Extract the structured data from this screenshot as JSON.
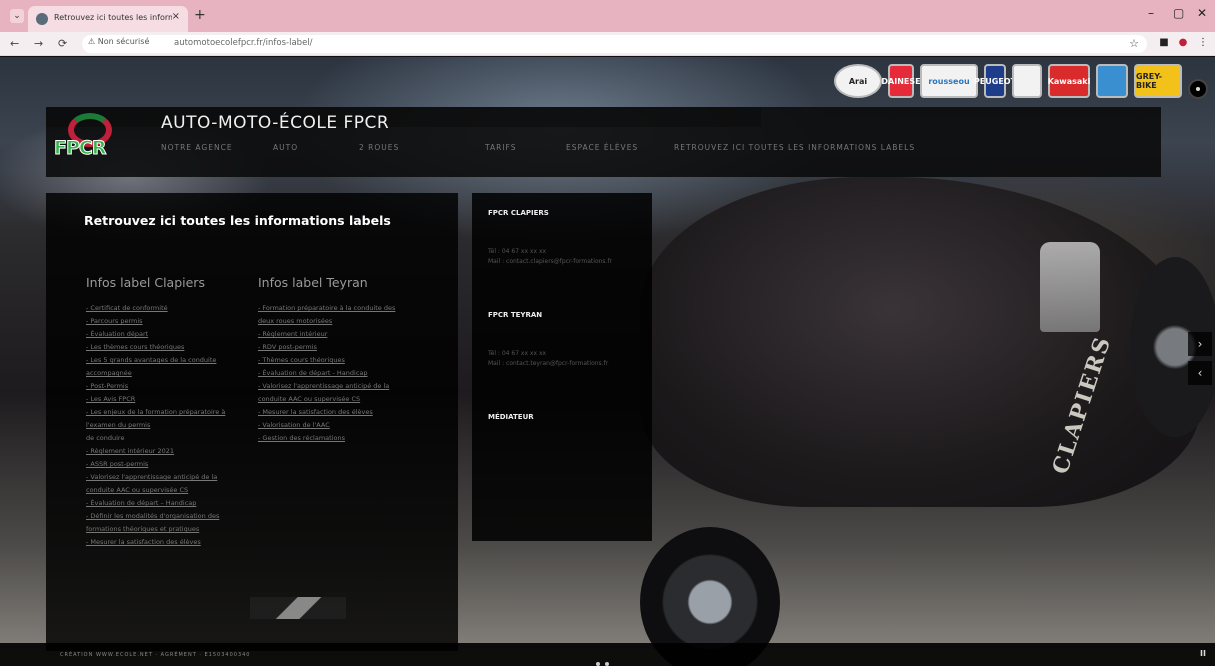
{
  "browser": {
    "tab_title": "Retrouvez ici toutes les inform",
    "tab_close": "×",
    "new_tab": "+",
    "security_label": "Non sécurisé",
    "url": "automotoecolefpcr.fr/infos-label/",
    "win_minimize": "–",
    "win_maximize": "▢",
    "win_close": "✕"
  },
  "sponsors": [
    "Arai",
    "DAINESE",
    "rousseou",
    "PEUGEOT",
    "",
    "Kawasaki",
    "",
    "GREY-BIKE"
  ],
  "header": {
    "logo_text": "FPCR",
    "site_title": "AUTO-MOTO-ÉCOLE FPCR",
    "nav": [
      "NOTRE AGENCE",
      "AUTO",
      "2 ROUES",
      "TARIFS",
      "ESPACE ÉLÈVES",
      "RETROUVEZ ICI TOUTES LES INFORMATIONS LABELS"
    ]
  },
  "main": {
    "title": "Retrouvez ici toutes les informations labels",
    "clapiers": {
      "heading": "Infos label Clapiers",
      "items": [
        "- Certificat de conformité",
        "- Parcours permis",
        "- Évaluation départ",
        "- Les thèmes cours théoriques",
        "- Les 5 grands avantages de la conduite",
        "accompagnée",
        "- Post-Permis",
        "- Les Avis FPCR",
        "- Les enjeux de la formation préparatoire à",
        "l'examen du permis",
        "de conduire",
        "- Règlement intérieur 2021",
        "- ASSR post-permis",
        "- Valorisez l'apprentissage anticipé de la",
        "conduite AAC ou supervisée CS",
        "- Évaluation de départ – Handicap",
        "- Définir les modalités d'organisation des",
        "formations théoriques et pratiques",
        "- Mesurer la satisfaction des élèves"
      ]
    },
    "teyran": {
      "heading": "Infos label Teyran",
      "items": [
        "- Formation préparatoire à la conduite des",
        "deux roues motorisées",
        "- Règlement intérieur",
        "- RDV post-permis",
        "- Thèmes cours théoriques",
        "- Évaluation de départ - Handicap",
        "- Valorisez l'apprentissage anticipé de la",
        "conduite AAC ou supervisée CS",
        "- Mesurer la satisfaction des élèves",
        "- Valorisation de l'AAC",
        "- Gestion des réclamations"
      ]
    }
  },
  "sidebar": {
    "clapiers": {
      "title": "FPCR CLAPIERS",
      "lines": [
        "",
        "",
        "Tél : 04 67 xx xx xx",
        "Mail : contact.clapiers@fpcr-formations.fr"
      ]
    },
    "teyran": {
      "title": "FPCR TEYRAN",
      "lines": [
        "",
        "",
        "Tél : 04 67 xx xx xx",
        "Mail : contact.teyran@fpcr-formations.fr"
      ]
    },
    "mediateur": {
      "title": "MÉDIATEUR",
      "lines": [
        "",
        "",
        ""
      ]
    }
  },
  "slider": {
    "next": "›",
    "prev": "‹",
    "pause": "II"
  },
  "footer": {
    "credit": "CRÉATION WWW.ECOLE.NET · AGRÉMENT · E1503400340"
  },
  "colors": {
    "tabbar": "#e8b3c1",
    "logo_green": "#36b24a",
    "logo_red": "#c0203a",
    "panel": "#000000"
  }
}
